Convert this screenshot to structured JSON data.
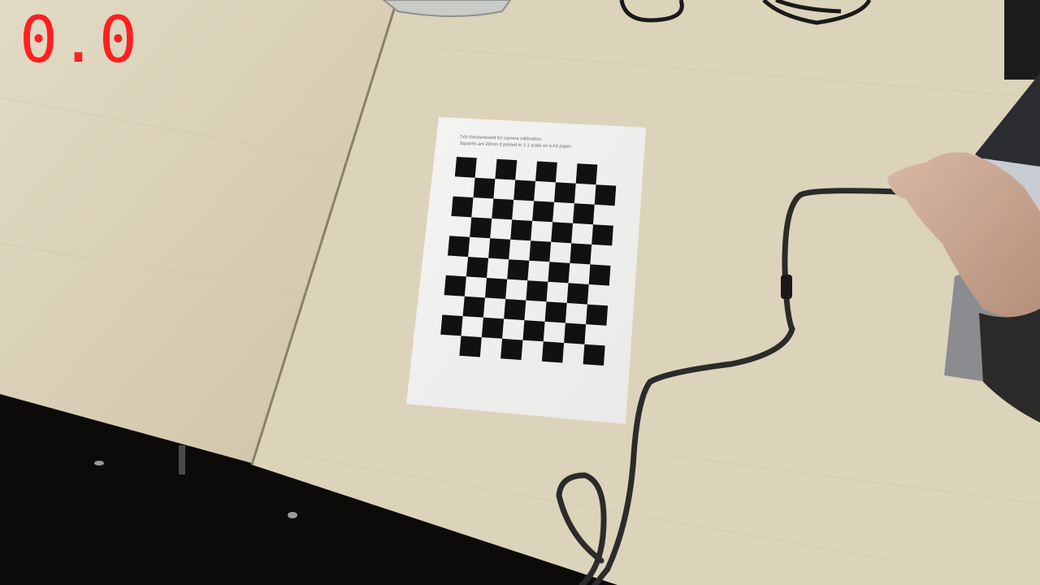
{
  "overlay": {
    "value_label": "0.0",
    "color": "#ff1f1f"
  },
  "calibration_sheet": {
    "note_line_1": "7x9 checkerboard for camera calibration.",
    "note_line_2": "Squares are 20mm if printed to 1:1 scale on a A4 paper.",
    "pattern_rows": 10,
    "pattern_cols": 8
  },
  "scene": {
    "desk_color": "#d9cfb6",
    "background_color": "#0c0b09",
    "cable_color": "#2b2b2b",
    "square_color": "#111111"
  }
}
